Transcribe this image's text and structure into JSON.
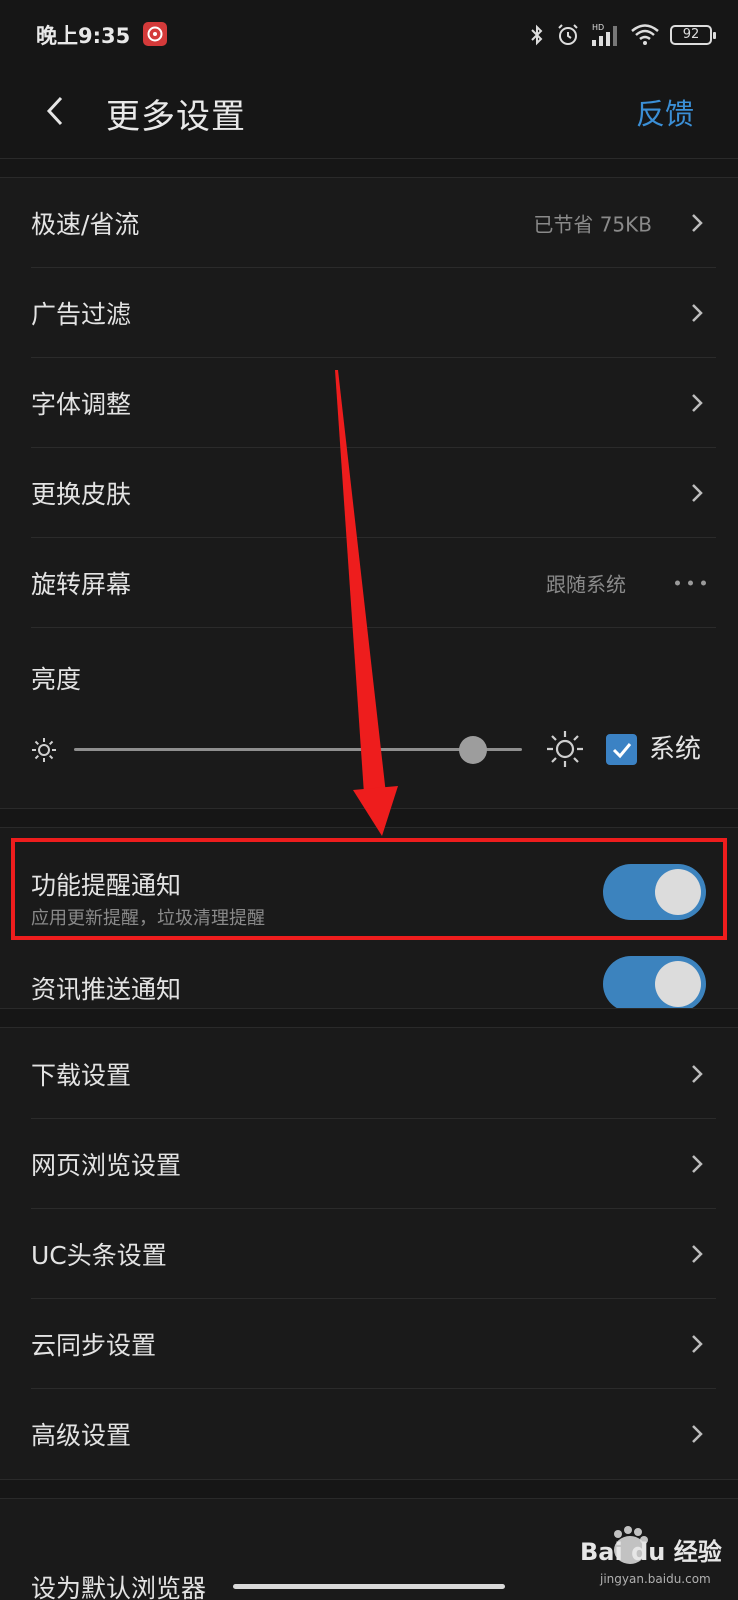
{
  "status_bar": {
    "time": "晚上9:35",
    "battery": "92",
    "network": "HD"
  },
  "header": {
    "title": "更多设置",
    "feedback": "反馈"
  },
  "section1": {
    "items": [
      {
        "label": "极速/省流",
        "value": "已节省 75KB"
      },
      {
        "label": "广告过滤"
      },
      {
        "label": "字体调整"
      },
      {
        "label": "更换皮肤"
      },
      {
        "label": "旋转屏幕",
        "value": "跟随系统"
      }
    ]
  },
  "brightness": {
    "label": "亮度",
    "level": 0.89,
    "system_checked": true,
    "system_label": "系统"
  },
  "notifications": {
    "feature": {
      "title": "功能提醒通知",
      "subtitle": "应用更新提醒，垃圾清理提醒",
      "on": true
    },
    "news": {
      "title": "资讯推送通知",
      "on": true
    }
  },
  "section3": {
    "items": [
      {
        "label": "下载设置"
      },
      {
        "label": "网页浏览设置"
      },
      {
        "label": "UC头条设置"
      },
      {
        "label": "云同步设置"
      },
      {
        "label": "高级设置"
      }
    ]
  },
  "bottom": {
    "partial_item": "设为默认浏览器"
  },
  "watermark": {
    "brand": "Bai du 经验",
    "url": "jingyan.baidu.com"
  },
  "colors": {
    "accent": "#3b8fd6",
    "toggle_on": "#3c83be",
    "annotation": "#ee1d1d",
    "background": "#1a1a1a"
  }
}
